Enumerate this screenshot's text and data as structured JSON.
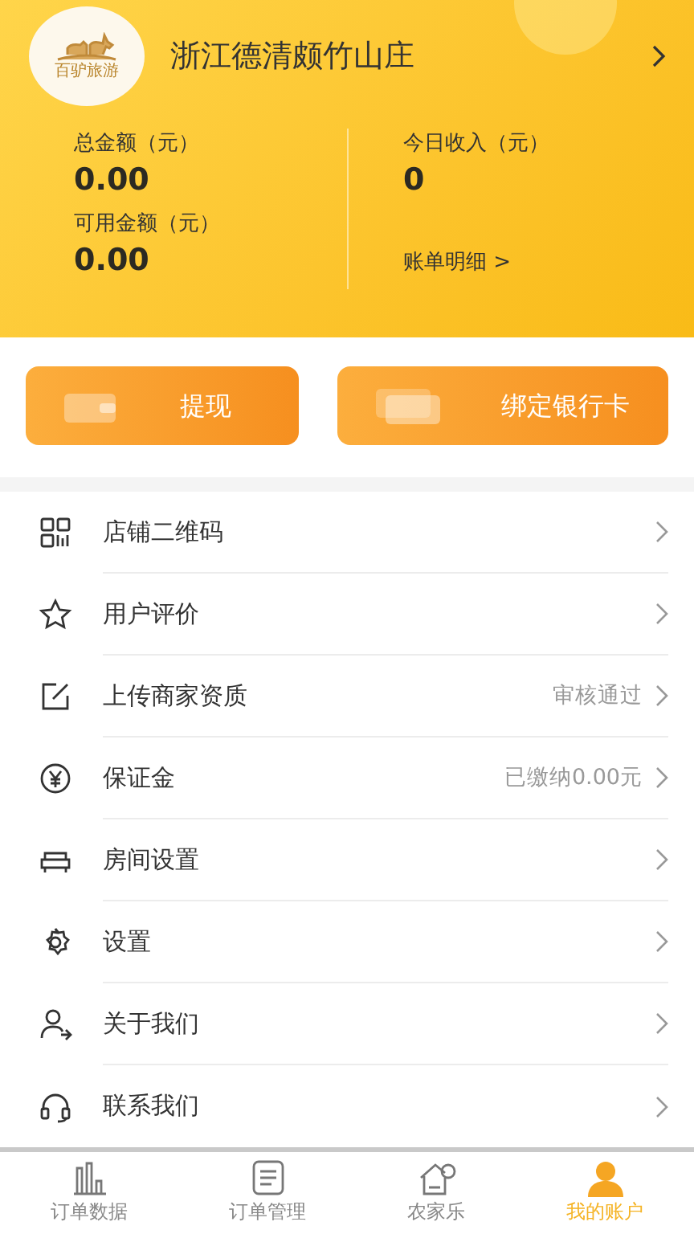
{
  "header": {
    "logo_text": "百驴旅游",
    "shop_name": "浙江德清颇竹山庄",
    "stats": [
      {
        "label": "总金额（元）",
        "value": "0.00"
      },
      {
        "label": "今日收入（元）",
        "value": "0"
      },
      {
        "label": "可用金额（元）",
        "value": "0.00"
      }
    ],
    "detail_link": "账单明细 >"
  },
  "actions": [
    {
      "label": "提现"
    },
    {
      "label": "绑定银行卡"
    }
  ],
  "menu": [
    {
      "label": "店铺二维码"
    },
    {
      "label": "用户评价"
    },
    {
      "label": "上传商家资质",
      "status": "审核通过"
    },
    {
      "label": "保证金",
      "status": "已缴纳0.00元"
    },
    {
      "label": "房间设置"
    },
    {
      "label": "设置"
    },
    {
      "label": "关于我们"
    },
    {
      "label": "联系我们"
    }
  ],
  "tabbar": [
    {
      "label": "订单数据",
      "selected": false
    },
    {
      "label": "订单管理",
      "selected": false
    },
    {
      "label": "农家乐",
      "selected": false
    },
    {
      "label": "我的账户",
      "selected": true
    }
  ]
}
